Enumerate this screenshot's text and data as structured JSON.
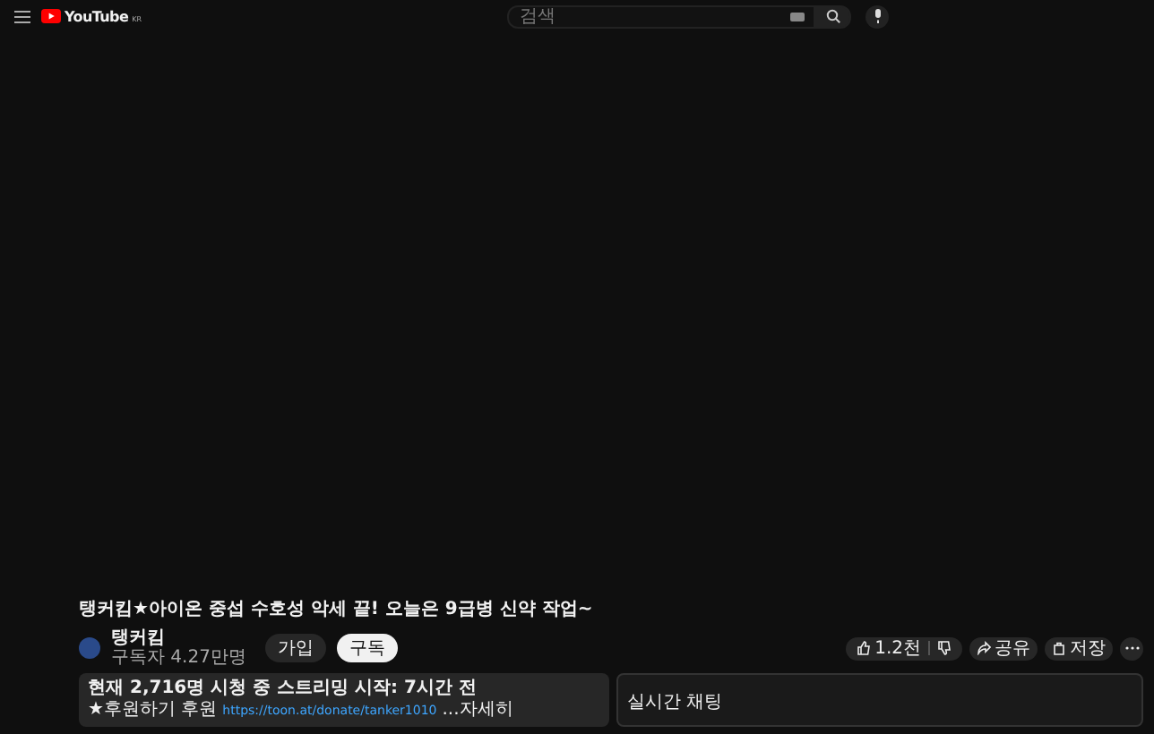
{
  "header": {
    "logo": "YouTube",
    "country": "KR",
    "search": {
      "placeholder": "검색"
    }
  },
  "video": {
    "title": "탱커킴★아이온 중섭 수호성 악세 끝! 오늘은 9급병 신약 작업~"
  },
  "channel": {
    "name": "탱커킴",
    "subscribers": "구독자 4.27만명",
    "join": "가입",
    "subscribe": "구독"
  },
  "actions": [
    {
      "kind": "like",
      "label": "1.2천"
    },
    {
      "kind": "share",
      "label": "공유"
    },
    {
      "kind": "save",
      "label": "저장"
    }
  ],
  "description": {
    "stats": "현재 2,716명 시청 중 스트리밍 시작: 7시간 전",
    "prefix": "★후원하기 후원",
    "link": "https://toon.at/donate/tanker1010",
    "more": "...자세히"
  },
  "chat": {
    "title": "실시간 채팅"
  }
}
